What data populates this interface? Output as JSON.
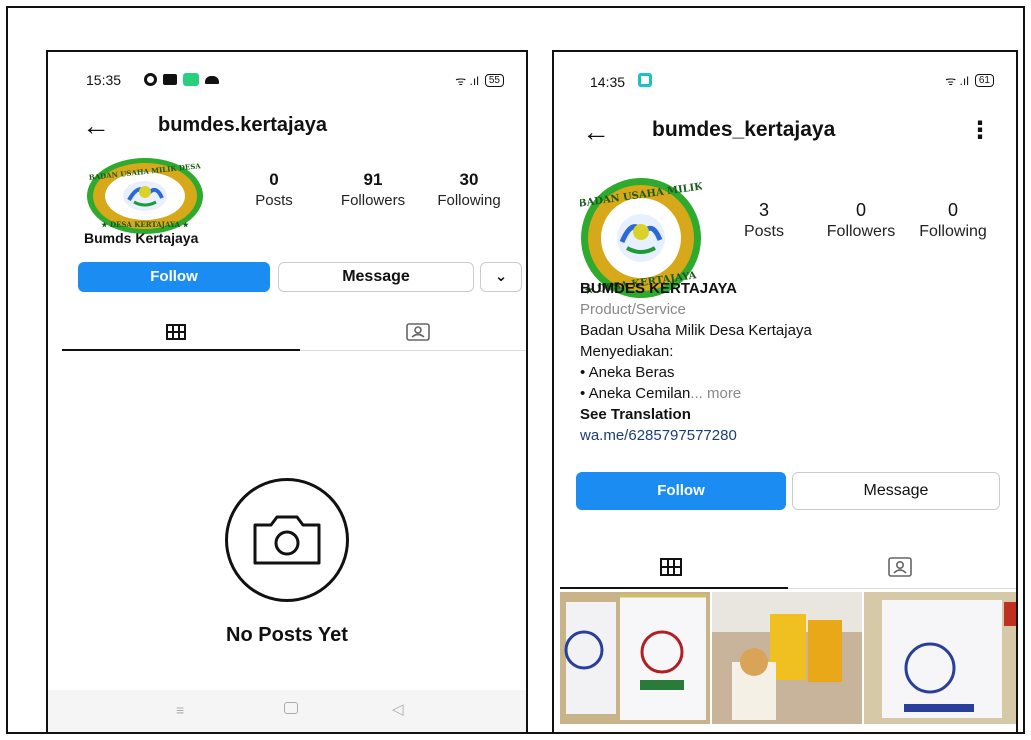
{
  "left": {
    "status": {
      "time": "15:35",
      "battery": "55"
    },
    "username": "bumdes.kertajaya",
    "stats": [
      {
        "value": "0",
        "label": "Posts"
      },
      {
        "value": "91",
        "label": "Followers"
      },
      {
        "value": "30",
        "label": "Following"
      }
    ],
    "display_name": "Bumds Kertajaya",
    "follow_label": "Follow",
    "message_label": "Message",
    "empty_title": "No Posts Yet"
  },
  "right": {
    "status": {
      "time": "14:35",
      "battery": "61"
    },
    "username": "bumdes_kertajaya",
    "stats": [
      {
        "value": "3",
        "label": "Posts"
      },
      {
        "value": "0",
        "label": "Followers"
      },
      {
        "value": "0",
        "label": "Following"
      }
    ],
    "bio": {
      "name": "BUMDES KERTAJAYA",
      "category": "Product/Service",
      "line1": "Badan Usaha Milik Desa Kertajaya",
      "line2": "Menyediakan:",
      "line3": "• Aneka Beras",
      "line4": "• Aneka Cemilan",
      "more": "... more",
      "see_translation": "See Translation",
      "link": "wa.me/6285797577280"
    },
    "follow_label": "Follow",
    "message_label": "Message"
  },
  "logo": {
    "top_text": "BADAN USAHA MILIK DESA",
    "bottom_text": "DESA KERTAJAYA"
  },
  "colors": {
    "follow_blue": "#1a8cf2",
    "link_blue": "#1c3c7a",
    "logo_green": "#2eaa2e",
    "logo_gold": "#d6a81a"
  }
}
